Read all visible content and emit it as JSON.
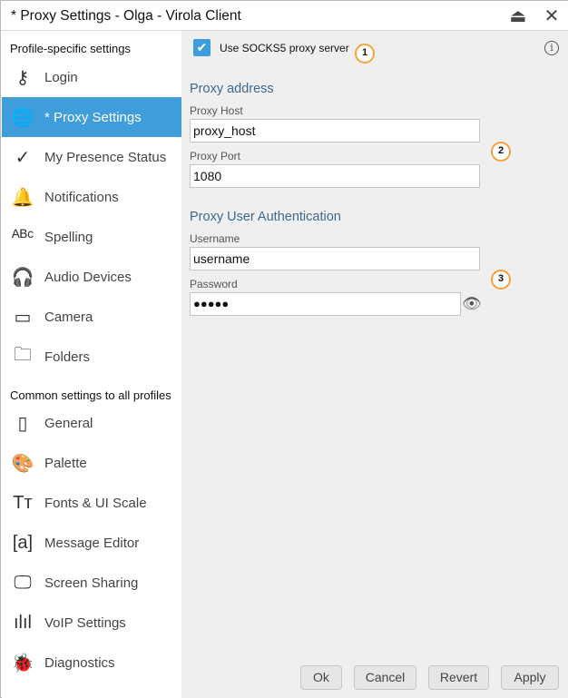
{
  "window": {
    "title": "* Proxy Settings - Olga - Virola Client",
    "eject_icon": "eject-icon",
    "close_icon": "close-icon"
  },
  "sidebar": {
    "profile_header": "Profile-specific settings",
    "common_header": "Common settings to all profiles",
    "profile_items": [
      {
        "label": "Login",
        "icon": "key-icon",
        "glyph": "⚷"
      },
      {
        "label": "* Proxy Settings",
        "icon": "globe-icon",
        "glyph": "🌐",
        "active": true
      },
      {
        "label": "My Presence Status",
        "icon": "check-circle-icon",
        "glyph": "✓"
      },
      {
        "label": "Notifications",
        "icon": "bell-icon",
        "glyph": "🔔"
      },
      {
        "label": "Spelling",
        "icon": "abc-check-icon",
        "glyph": "ᴬᴮᶜ"
      },
      {
        "label": "Audio Devices",
        "icon": "headset-icon",
        "glyph": "🎧"
      },
      {
        "label": "Camera",
        "icon": "camera-icon",
        "glyph": "▭"
      },
      {
        "label": "Folders",
        "icon": "folder-search-icon",
        "glyph": "🗀"
      }
    ],
    "common_items": [
      {
        "label": "General",
        "icon": "general-icon",
        "glyph": "▯"
      },
      {
        "label": "Palette",
        "icon": "palette-icon",
        "glyph": "🎨"
      },
      {
        "label": "Fonts & UI Scale",
        "icon": "font-scale-icon",
        "glyph": "Tт"
      },
      {
        "label": "Message Editor",
        "icon": "message-editor-icon",
        "glyph": "[a]"
      },
      {
        "label": "Screen Sharing",
        "icon": "screen-share-icon",
        "glyph": "🖵"
      },
      {
        "label": "VoIP Settings",
        "icon": "waveform-icon",
        "glyph": "ılıl"
      },
      {
        "label": "Diagnostics",
        "icon": "bug-icon",
        "glyph": "🐞"
      }
    ]
  },
  "main": {
    "use_socks5": {
      "label": "Use SOCKS5 proxy server",
      "checked": true
    },
    "badges": [
      "1",
      "2",
      "3"
    ],
    "proxy_address_header": "Proxy address",
    "proxy_host_label": "Proxy Host",
    "proxy_host_value": "proxy_host",
    "proxy_port_label": "Proxy Port",
    "proxy_port_value": "1080",
    "auth_header": "Proxy User Authentication",
    "username_label": "Username",
    "username_value": "username",
    "password_label": "Password",
    "password_value": "●●●●●"
  },
  "buttons": {
    "ok": "Ok",
    "cancel": "Cancel",
    "revert": "Revert",
    "apply": "Apply"
  },
  "colors": {
    "accent": "#3f9ddb",
    "badge": "#f7a33a",
    "header": "#3c6a8e"
  }
}
